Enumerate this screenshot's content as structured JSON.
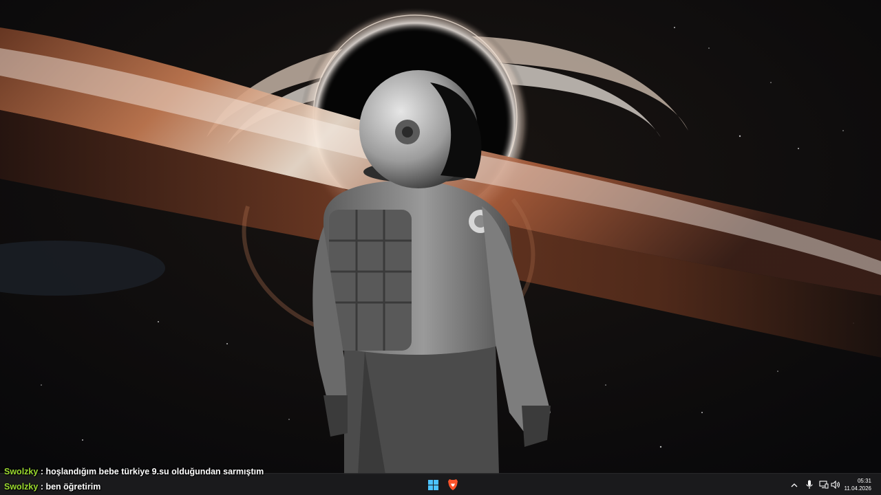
{
  "wallpaper": {
    "subject": "astronaut-before-black-hole",
    "colors": {
      "space": "#0b0b0d",
      "disk_hot": "#f3e8de",
      "disk_orange": "#b8643c",
      "disk_dark": "#3a1d14",
      "suit": "#8c8c8c"
    }
  },
  "chat": {
    "messages": [
      {
        "user": "Swolzky",
        "separator": ":",
        "text": "hoşlandığım bebe türkiye 9.su olduğundan sarmıştım"
      },
      {
        "user": "Swolzky",
        "separator": ":",
        "text": "ben öğretirim"
      }
    ],
    "user_color": "#9ad92f"
  },
  "taskbar": {
    "pinned": [
      {
        "name": "start",
        "icon": "windows-logo-icon"
      },
      {
        "name": "brave-browser",
        "icon": "brave-lion-icon"
      }
    ],
    "tray": {
      "icons": [
        "chevron-up-icon",
        "microphone-icon",
        "network-icon",
        "speaker-icon"
      ],
      "time": "05:31",
      "date": "11.04.2026"
    }
  }
}
